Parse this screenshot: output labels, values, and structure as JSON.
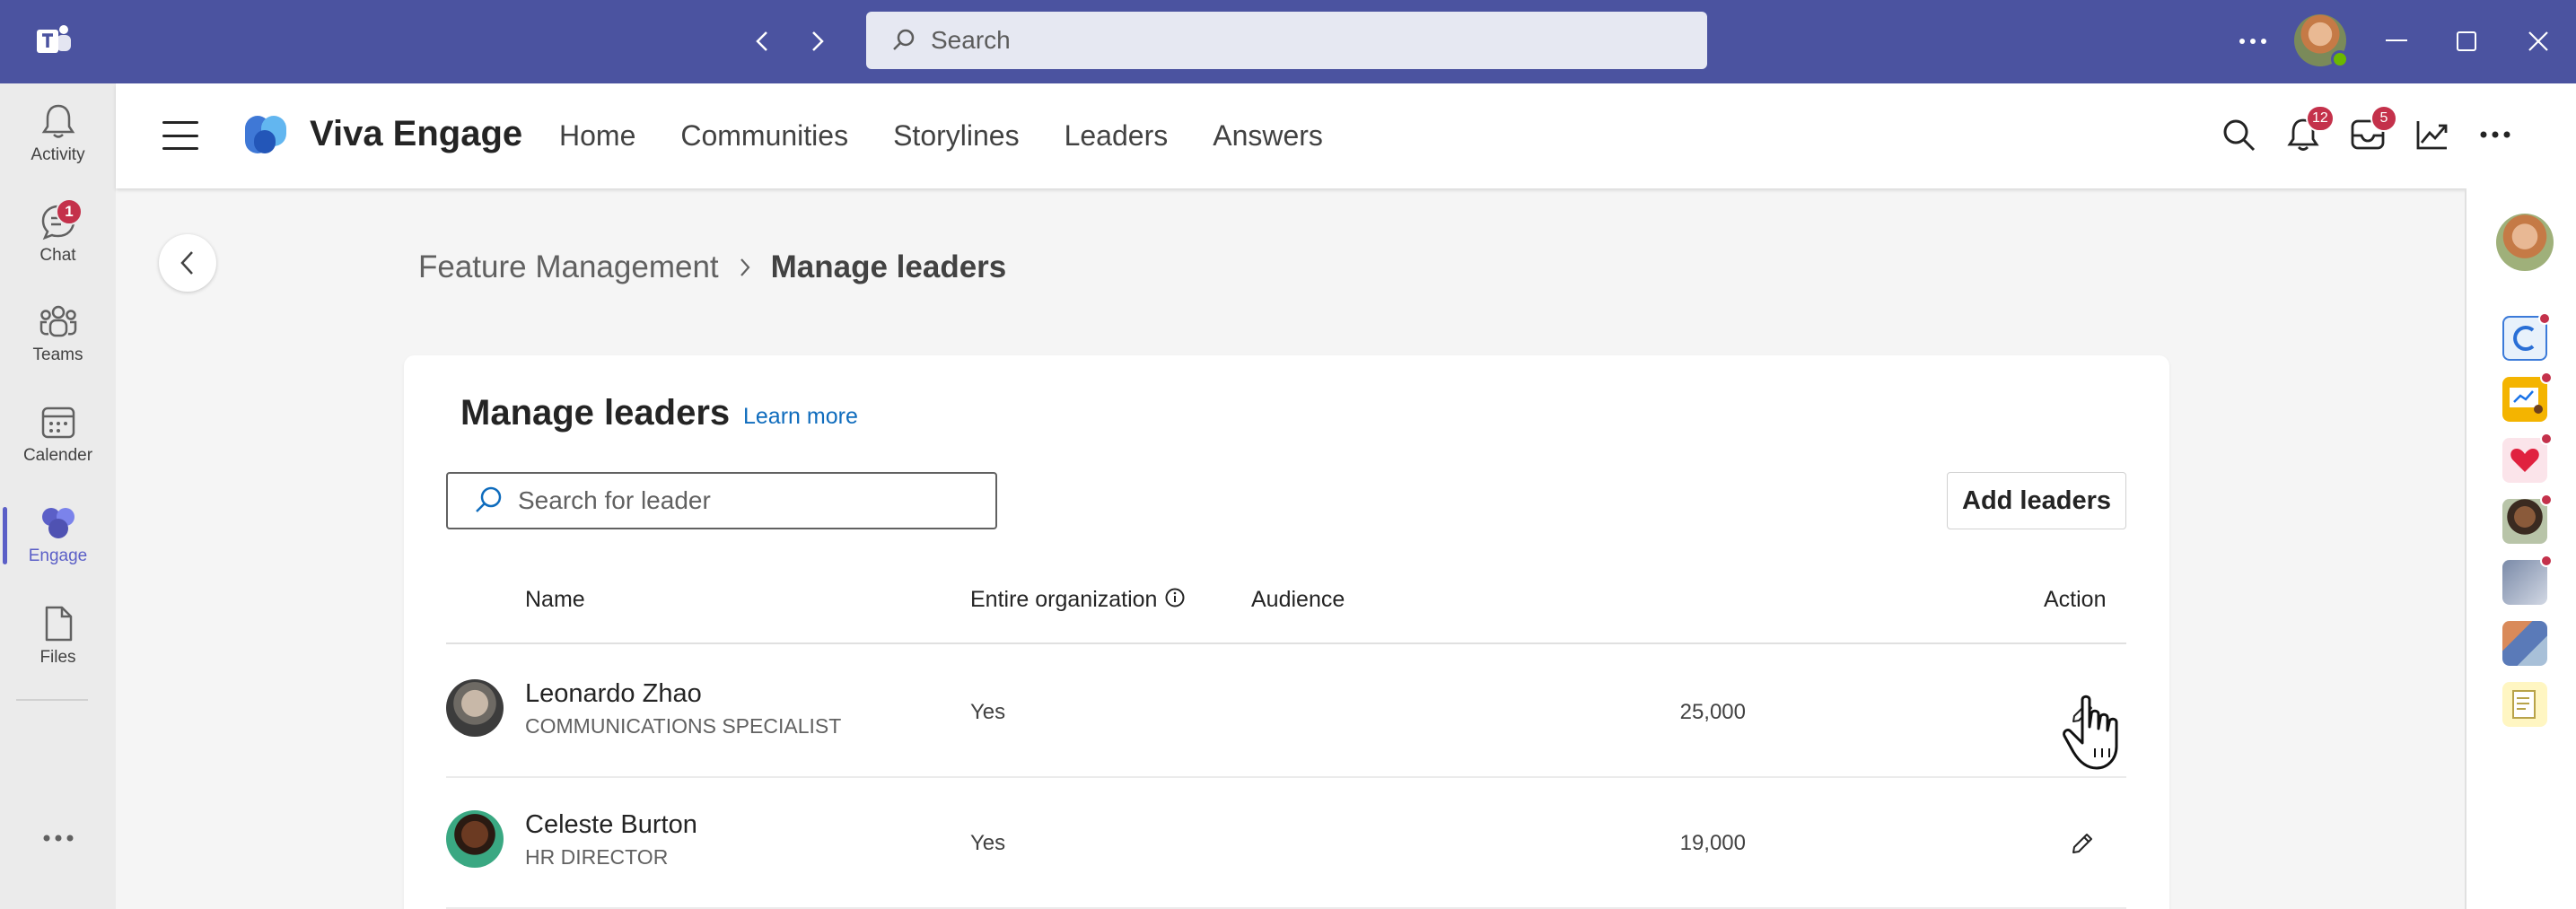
{
  "titlebar": {
    "search_placeholder": "Search",
    "icons": [
      "teams-logo",
      "back-arrow",
      "forward-arrow",
      "search-icon",
      "more-icon",
      "minimize-icon",
      "maximize-icon",
      "close-icon"
    ]
  },
  "rail": {
    "items": [
      {
        "label": "Activity",
        "icon": "bell-icon"
      },
      {
        "label": "Chat",
        "icon": "chat-icon",
        "badge": "1"
      },
      {
        "label": "Teams",
        "icon": "teams-icon"
      },
      {
        "label": "Calender",
        "icon": "calendar-icon"
      },
      {
        "label": "Engage",
        "icon": "engage-icon",
        "active": true
      },
      {
        "label": "Files",
        "icon": "file-icon"
      }
    ],
    "accent": "#5b5fc7"
  },
  "header": {
    "brand": "Viva Engage",
    "nav": [
      "Home",
      "Communities",
      "Storylines",
      "Leaders",
      "Answers"
    ],
    "notifications_badge": "12",
    "inbox_badge": "5"
  },
  "breadcrumb": {
    "parent": "Feature Management",
    "current": "Manage leaders"
  },
  "card": {
    "title": "Manage leaders",
    "learn_more": "Learn more",
    "search_placeholder": "Search for leader",
    "add_button": "Add leaders",
    "columns": {
      "name": "Name",
      "entire_org": "Entire organization",
      "audience": "Audience",
      "action": "Action"
    },
    "rows": [
      {
        "name": "Leonardo Zhao",
        "title": "COMMUNICATIONS SPECIALIST",
        "entire_org": "Yes",
        "audience": "25,000"
      },
      {
        "name": "Celeste Burton",
        "title": "HR DIRECTOR",
        "entire_org": "Yes",
        "audience": "19,000"
      }
    ]
  },
  "colors": {
    "titlebar": "#4b53a0",
    "link": "#0f6cbd",
    "badge": "#c4314b"
  }
}
